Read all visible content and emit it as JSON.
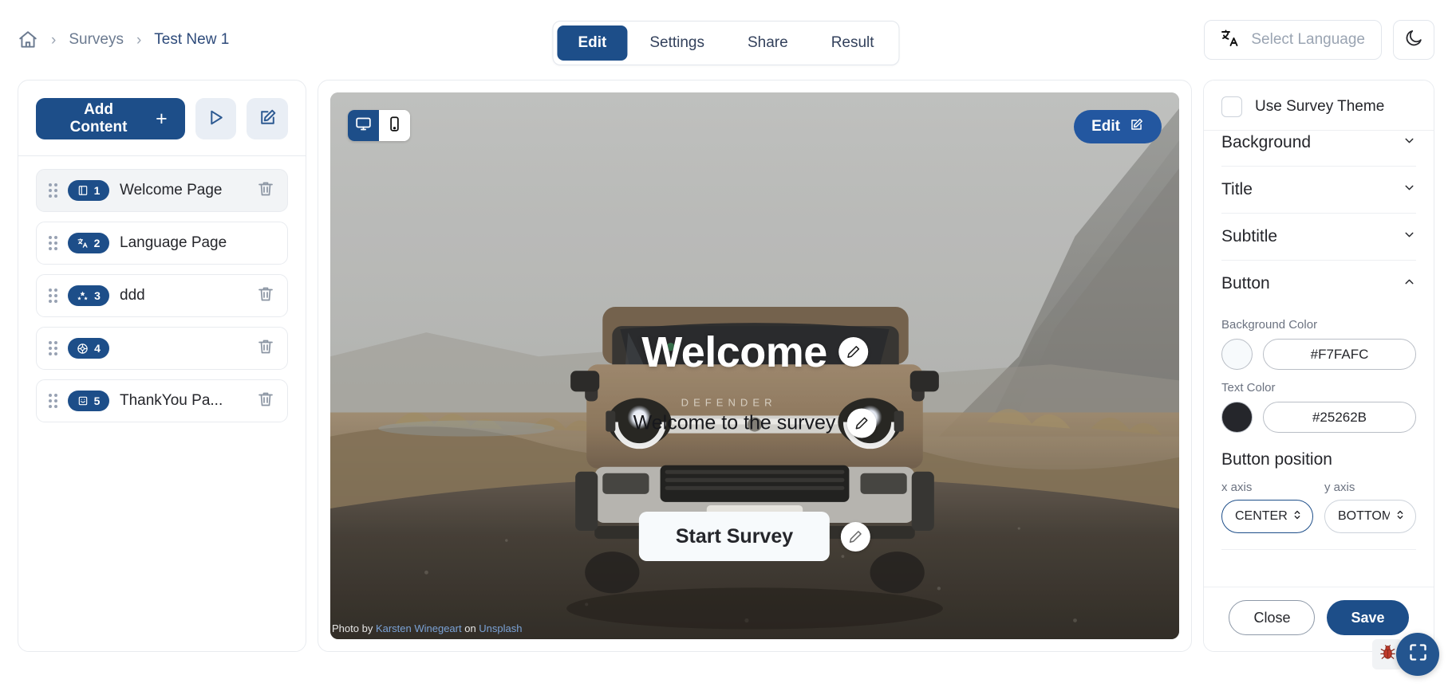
{
  "breadcrumb": {
    "home_icon": "home-icon",
    "items": [
      "Surveys",
      "Test New 1"
    ],
    "separator": "›"
  },
  "tabs": [
    {
      "label": "Edit",
      "active": true
    },
    {
      "label": "Settings",
      "active": false
    },
    {
      "label": "Share",
      "active": false
    },
    {
      "label": "Result",
      "active": false
    }
  ],
  "header": {
    "language_placeholder": "Select Language",
    "language_icon": "translate-icon",
    "theme_toggle_icon": "moon-icon"
  },
  "sidebar": {
    "add_content_label": "Add Content",
    "add_content_plus": "+",
    "preview_icon": "play-icon",
    "rename_icon": "edit-pencil-square-icon",
    "pages": [
      {
        "number": "1",
        "label": "Welcome Page",
        "icon": "book-page-icon",
        "selected": true,
        "deletable": false
      },
      {
        "number": "2",
        "label": "Language Page",
        "icon": "translate-icon",
        "selected": false,
        "deletable": false
      },
      {
        "number": "3",
        "label": "ddd",
        "icon": "stars-rating-icon",
        "selected": false,
        "deletable": true
      },
      {
        "number": "4",
        "label": "",
        "icon": "wheel-icon",
        "selected": false,
        "deletable": true
      },
      {
        "number": "5",
        "label": "ThankYou Pa...",
        "icon": "thankyou-page-icon",
        "selected": false,
        "deletable": true
      }
    ]
  },
  "preview": {
    "device_desktop_icon": "desktop-icon",
    "device_mobile_icon": "mobile-icon",
    "active_device": "desktop",
    "edit_button_label": "Edit",
    "edit_button_icon": "edit-pencil-square-icon",
    "title": "Welcome",
    "subtitle": "Welcome to the survey",
    "cta_label": "Start Survey",
    "edit_dot_icon": "pencil-icon",
    "credit": {
      "prefix": "Photo by ",
      "author": "Karsten Winegeart",
      "middle": " on ",
      "source": "Unsplash"
    }
  },
  "settings_panel": {
    "use_survey_theme_label": "Use Survey Theme",
    "use_survey_theme_checked": false,
    "sections": [
      {
        "title": "Background",
        "expanded": false
      },
      {
        "title": "Title",
        "expanded": false
      },
      {
        "title": "Subtitle",
        "expanded": false
      },
      {
        "title": "Button",
        "expanded": true
      }
    ],
    "button_section": {
      "background_color_label": "Background Color",
      "background_color_value": "#F7FAFC",
      "text_color_label": "Text Color",
      "text_color_value": "#25262B",
      "position_title": "Button position",
      "x_axis_label": "x axis",
      "x_axis_value": "CENTER",
      "y_axis_label": "y axis",
      "y_axis_value": "BOTTOM"
    },
    "close_label": "Close",
    "save_label": "Save"
  },
  "floating": {
    "bug_icon": "bug-icon",
    "fullscreen_icon": "fullscreen-scan-icon"
  },
  "colors": {
    "primary": "#1d4e89",
    "primary_light": "#2357a0",
    "button_background": "#F7FAFC",
    "button_text": "#25262B"
  }
}
